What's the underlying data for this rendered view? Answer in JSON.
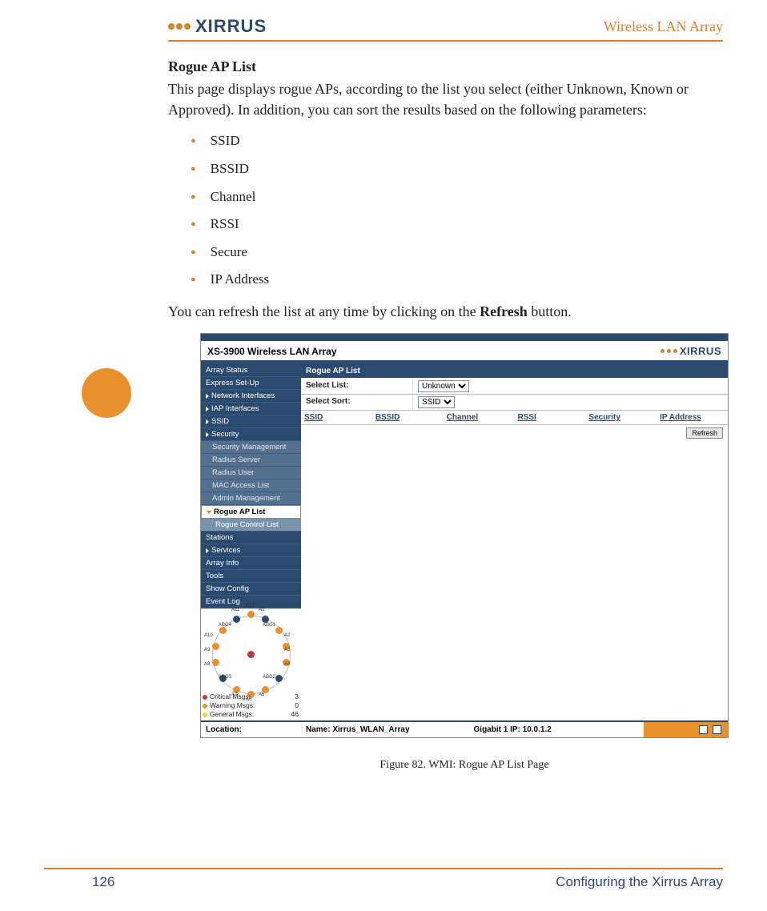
{
  "header": {
    "logo_text": "XIRRUS",
    "title": "Wireless LAN Array"
  },
  "section": {
    "title": "Rogue AP List",
    "intro": "This page displays rogue APs, according to the list you select (either Unknown, Known or Approved). In addition, you can sort the results based on the following parameters:",
    "bullets": [
      "SSID",
      "BSSID",
      "Channel",
      "RSSI",
      "Secure",
      "IP Address"
    ],
    "after_pre": "You can refresh the list at any time by clicking on the ",
    "after_bold": "Refresh",
    "after_post": " button."
  },
  "screenshot": {
    "title": "XS-3900 Wireless LAN Array",
    "logo": "XIRRUS",
    "side": [
      {
        "label": "Array Status",
        "type": "main"
      },
      {
        "label": "Express Set-Up",
        "type": "main"
      },
      {
        "label": "Network Interfaces",
        "type": "main",
        "arrow": true
      },
      {
        "label": "IAP Interfaces",
        "type": "main",
        "arrow": true
      },
      {
        "label": "SSID",
        "type": "main",
        "arrow": true
      },
      {
        "label": "Security",
        "type": "main",
        "arrow": true
      },
      {
        "label": "Security Management",
        "type": "sub"
      },
      {
        "label": "Radius Server",
        "type": "sub"
      },
      {
        "label": "Radius User",
        "type": "sub"
      },
      {
        "label": "MAC Access List",
        "type": "sub"
      },
      {
        "label": "Admin Management",
        "type": "sub"
      },
      {
        "label": "Rogue AP List",
        "type": "active"
      },
      {
        "label": "Rogue Control List",
        "type": "active-sub"
      },
      {
        "label": "Stations",
        "type": "main"
      },
      {
        "label": "Services",
        "type": "main",
        "arrow": true
      },
      {
        "label": "Array Info",
        "type": "main"
      },
      {
        "label": "Tools",
        "type": "main"
      },
      {
        "label": "Show Config",
        "type": "main"
      },
      {
        "label": "Event Log",
        "type": "main"
      }
    ],
    "content_title": "Rogue AP List",
    "select_list_label": "Select List:",
    "select_list_value": "Unknown",
    "select_sort_label": "Select Sort:",
    "select_sort_value": "SSID",
    "columns": [
      "SSID",
      "BSSID",
      "Channel",
      "RSSI",
      "Security",
      "IP Address"
    ],
    "refresh": "Refresh",
    "antennas": [
      "A1",
      "A2",
      "A3",
      "A4",
      "A5",
      "A6",
      "A7",
      "A8",
      "A9",
      "A10",
      "A11",
      "A12",
      "ABG1",
      "ABG2",
      "ABG3",
      "ABG4"
    ],
    "msgs": [
      {
        "label": "Critical Msgs:",
        "n": "3",
        "c": "r"
      },
      {
        "label": "Warning Msgs:",
        "n": "0",
        "c": "o"
      },
      {
        "label": "General Msgs:",
        "n": "46",
        "c": "y"
      }
    ],
    "footer": {
      "location": "Location:",
      "name_lbl": "Name:",
      "name_val": "Xirrus_WLAN_Array",
      "gig_lbl": "Gigabit 1 IP:",
      "gig_val": "10.0.1.2"
    }
  },
  "figure_caption": "Figure 82. WMI: Rogue AP List Page",
  "page_footer": {
    "page": "126",
    "text": "Configuring the Xirrus Array"
  }
}
